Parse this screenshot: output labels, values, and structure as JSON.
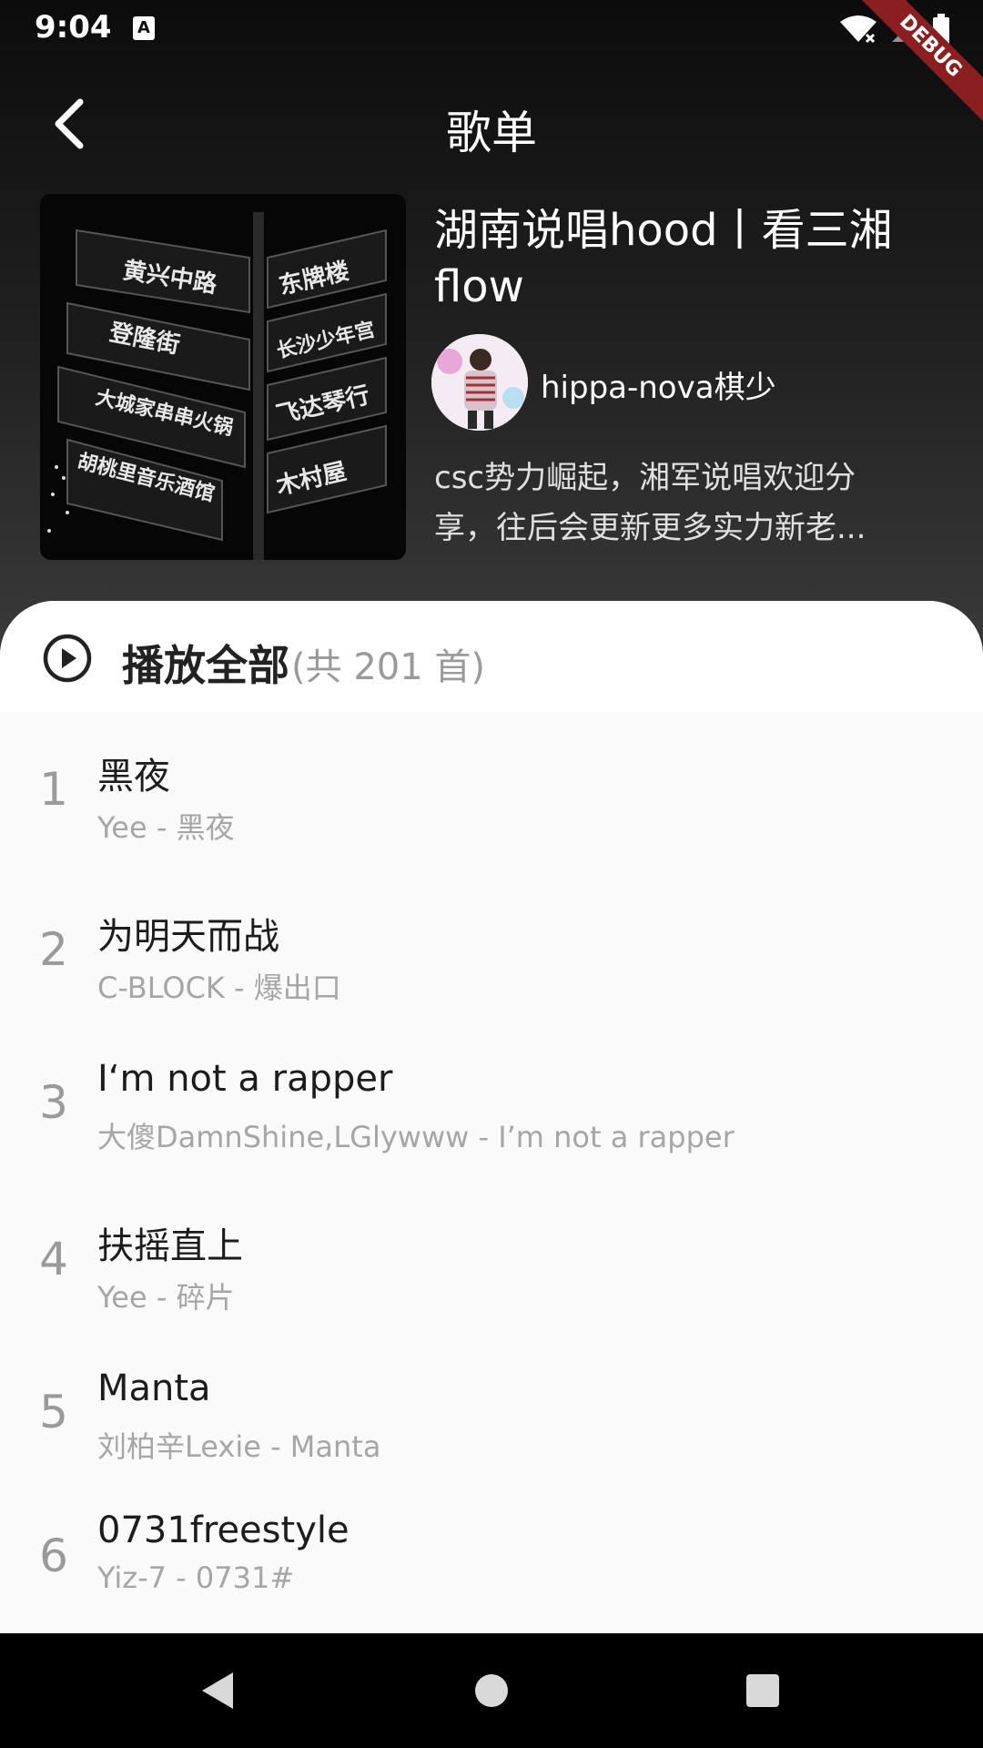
{
  "status_bar": {
    "time": "9:04",
    "a_badge": "A",
    "debug": "DEBUG"
  },
  "app_bar": {
    "title": "歌单"
  },
  "playlist": {
    "title": "湖南说唱hood丨看三湘flow",
    "creator": "hippa-nova棋少",
    "description": "csc势力崛起，湘军说唱欢迎分享，往后会更新更多实力新老..."
  },
  "play_all": {
    "label": "播放全部",
    "count": "(共 201 首)"
  },
  "songs": [
    {
      "index": "1",
      "title": "黑夜",
      "subtitle": "Yee - 黑夜"
    },
    {
      "index": "2",
      "title": "为明天而战",
      "subtitle": "C-BLOCK - 爆出口"
    },
    {
      "index": "3",
      "title": "I‘m not a rapper",
      "subtitle": "大傻DamnShine,LGlywww - I’m not a rapper"
    },
    {
      "index": "4",
      "title": "扶摇直上",
      "subtitle": "Yee - 碎片"
    },
    {
      "index": "5",
      "title": "Manta",
      "subtitle": "刘柏辛Lexie - Manta"
    },
    {
      "index": "6",
      "title": "0731freestyle",
      "subtitle": "Yiz-7 - 0731#"
    }
  ],
  "colors": {
    "accent": "#ffffff",
    "list_bg": "#fafafa",
    "subtle_text": "#a6a6a6",
    "debug_ribbon": "#8b1e1e"
  }
}
